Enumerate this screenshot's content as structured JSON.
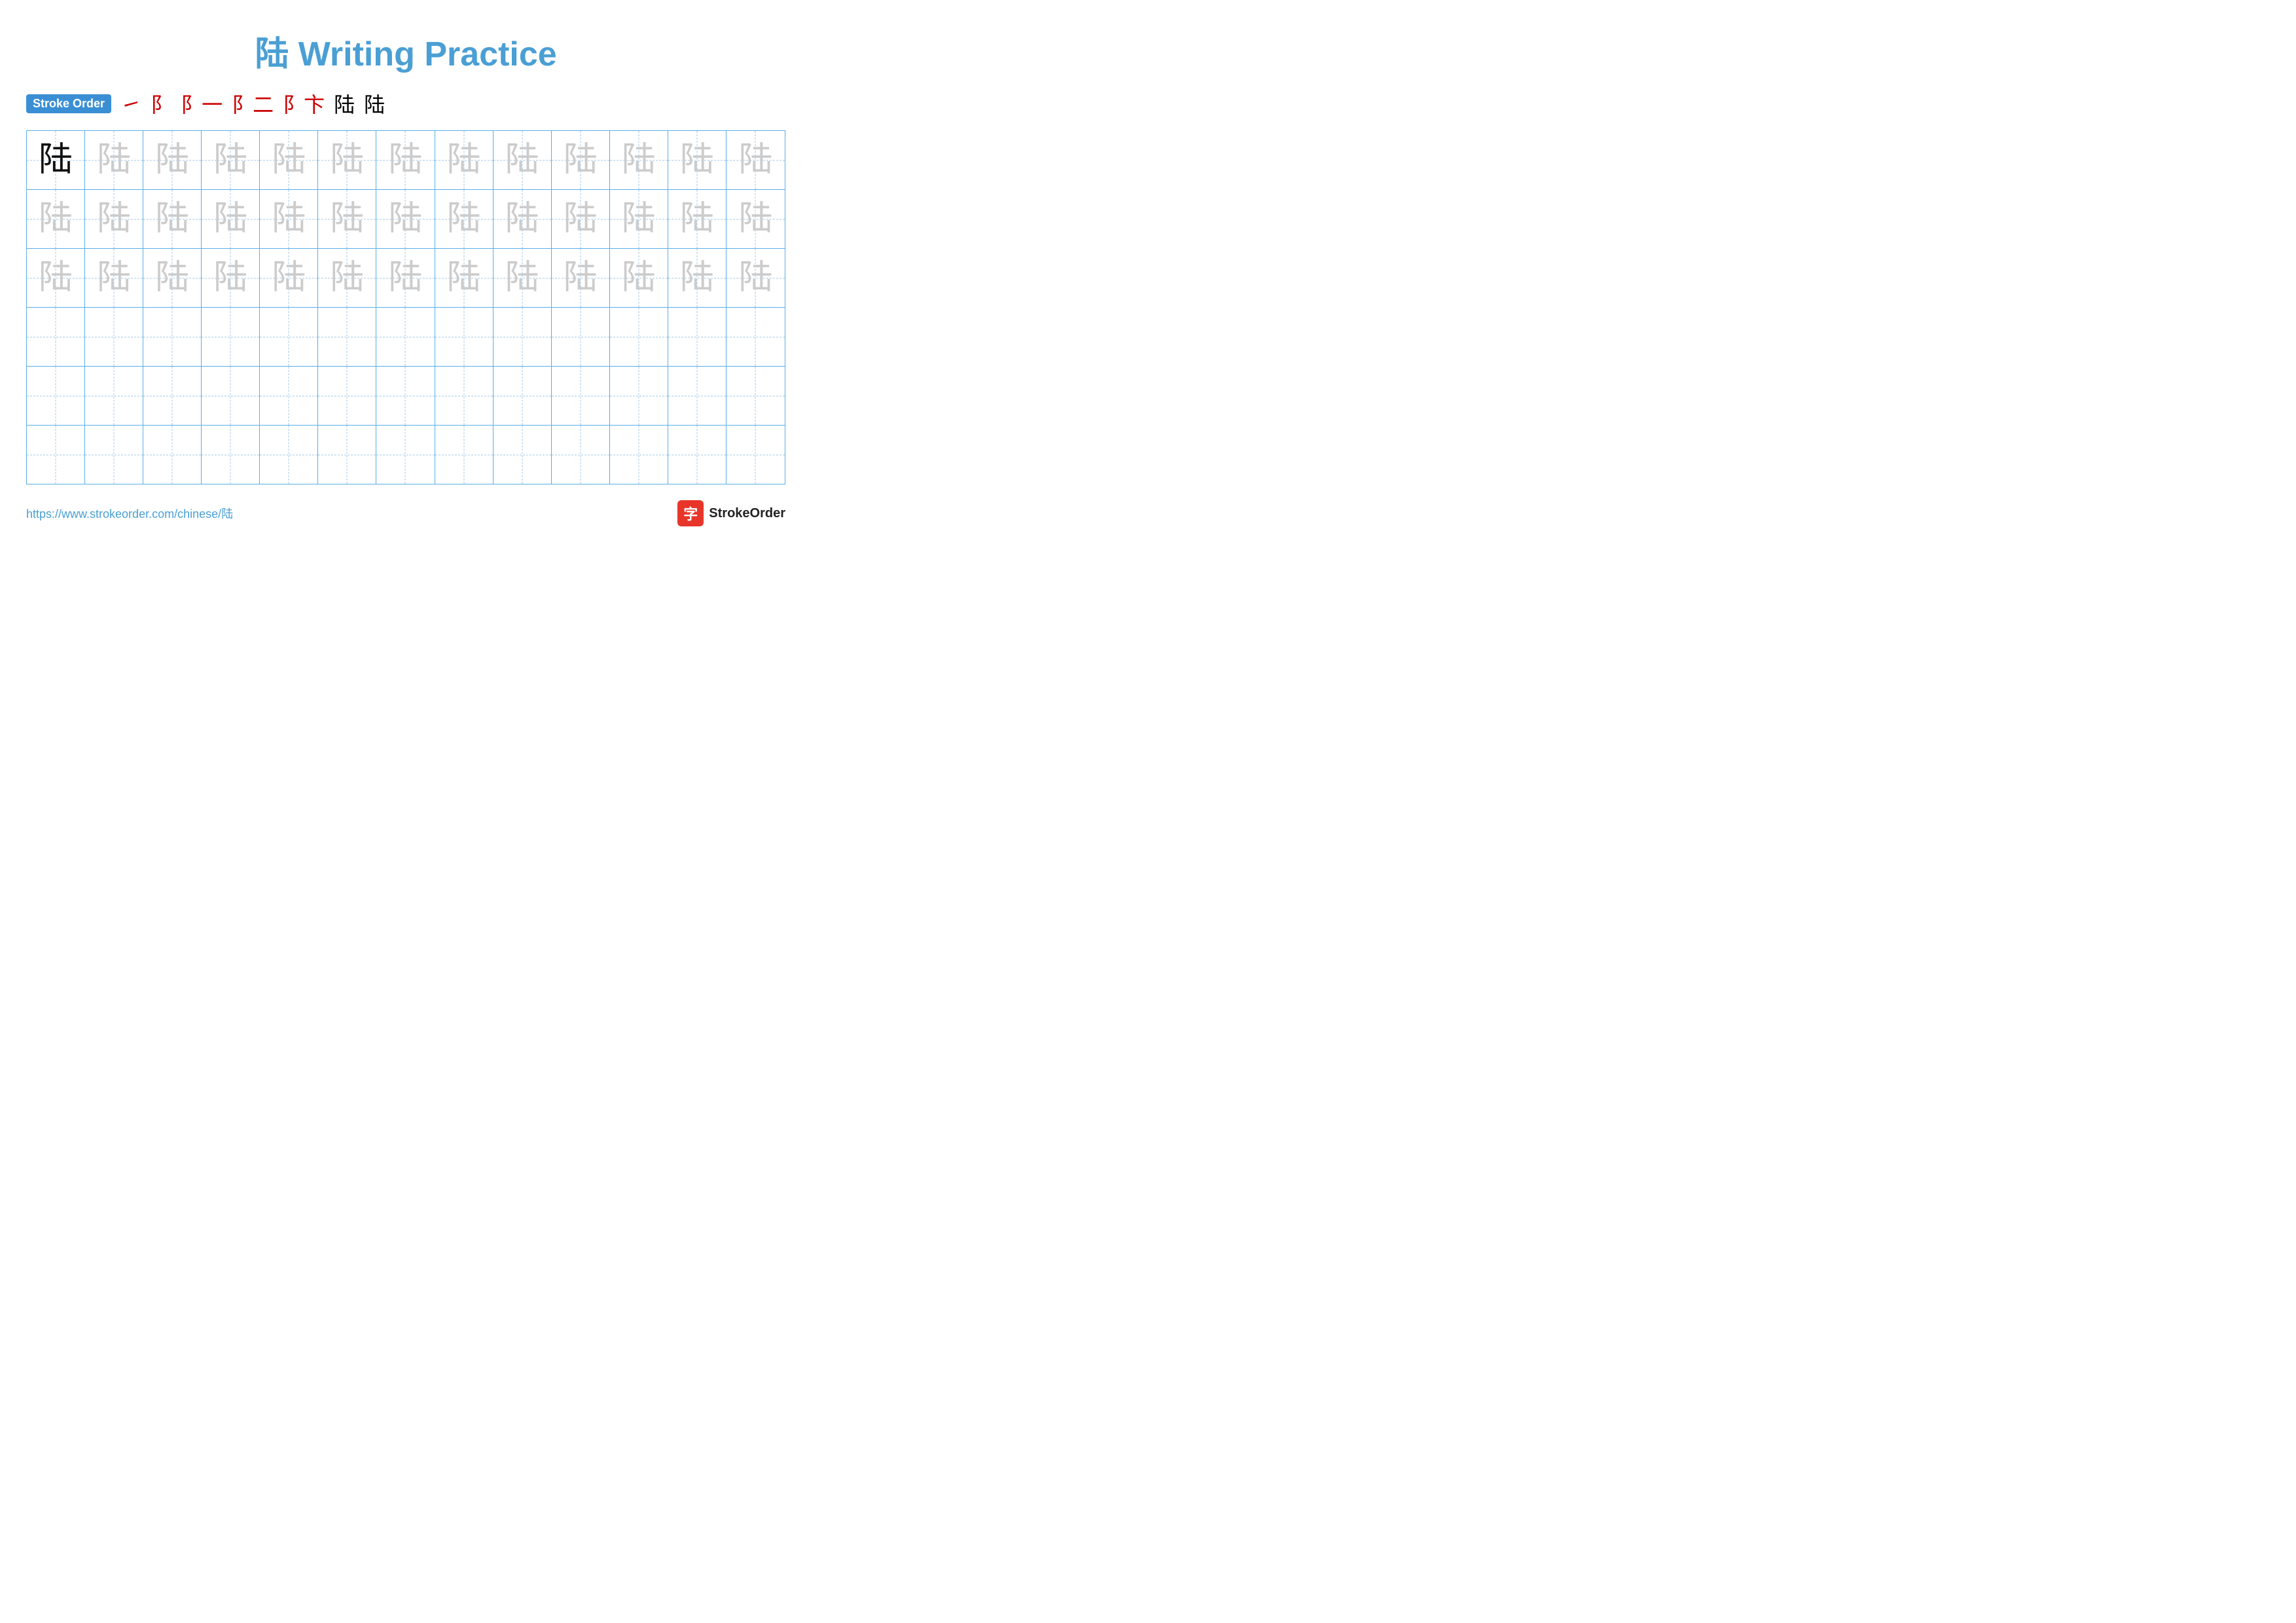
{
  "title": "陆 Writing Practice",
  "stroke_order": {
    "badge": "Stroke Order",
    "steps": [
      "㇀",
      "阝",
      "阝一",
      "阝二",
      "阝卞",
      "陆",
      "陆"
    ]
  },
  "grid": {
    "rows": 6,
    "cols": 13,
    "character": "陆",
    "row_types": [
      "dark_first_light_rest",
      "all_light",
      "all_light",
      "empty",
      "empty",
      "empty"
    ]
  },
  "footer": {
    "url": "https://www.strokeorder.com/chinese/陆",
    "logo_char": "字",
    "logo_text": "StrokeOrder"
  }
}
